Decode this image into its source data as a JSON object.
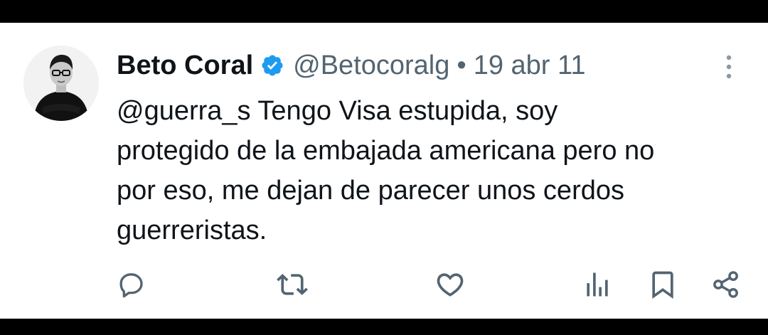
{
  "tweet": {
    "author": {
      "display_name": "Beto Coral",
      "handle": "@Betocoralg",
      "verified": true,
      "avatar_icon": "person-in-glasses-avatar"
    },
    "separator": "•",
    "date": "19 abr 11",
    "text_lines": [
      "@guerra_s Tengo Visa estupida, soy",
      "protegido de la embajada americana pero no",
      "por eso, me dejan de parecer unos cerdos",
      "guerreristas."
    ],
    "actions": [
      {
        "icon": "reply-icon"
      },
      {
        "icon": "retweet-icon"
      },
      {
        "icon": "like-icon"
      },
      {
        "icon": "views-icon"
      },
      {
        "icon": "bookmark-icon"
      },
      {
        "icon": "share-icon"
      }
    ]
  },
  "colors": {
    "text_primary": "#0f1419",
    "text_secondary": "#536471",
    "verified_blue": "#1d9bf0",
    "background": "#ffffff",
    "frame": "#000000"
  }
}
